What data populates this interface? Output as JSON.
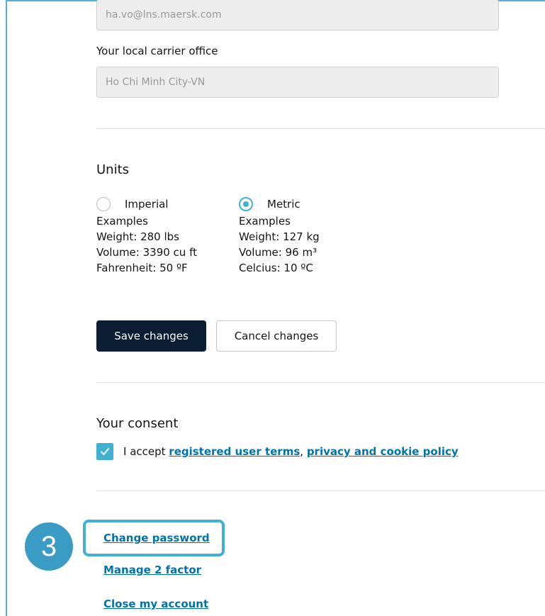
{
  "account": {
    "email_value": "ha.vo@lns.maersk.com",
    "office_label": "Your local carrier office",
    "office_value": "Ho Chi Minh City-VN"
  },
  "units": {
    "heading": "Units",
    "imperial": {
      "label": "Imperial",
      "examples_title": "Examples",
      "weight": "Weight: 280 lbs",
      "volume": "Volume: 3390 cu ft",
      "temperature": "Fahrenheit: 50 ºF",
      "selected": false
    },
    "metric": {
      "label": "Metric",
      "examples_title": "Examples",
      "weight": "Weight: 127 kg",
      "volume": "Volume: 96 m³",
      "temperature": "Celcius: 10 ºC",
      "selected": true
    }
  },
  "actions": {
    "save_label": "Save changes",
    "cancel_label": "Cancel changes"
  },
  "consent": {
    "heading": "Your consent",
    "checked": true,
    "prefix": "I accept",
    "terms_link": "registered user terms",
    "separator": ",",
    "privacy_link": "privacy and cookie policy"
  },
  "links": {
    "change_password": "Change password",
    "manage_2fa": "Manage 2 factor",
    "close_account": "Close my account"
  },
  "annotation": {
    "step_number": "3"
  },
  "colors": {
    "accent": "#42b0d5",
    "primary_button": "#0b1d33",
    "link": "#0073ab"
  }
}
